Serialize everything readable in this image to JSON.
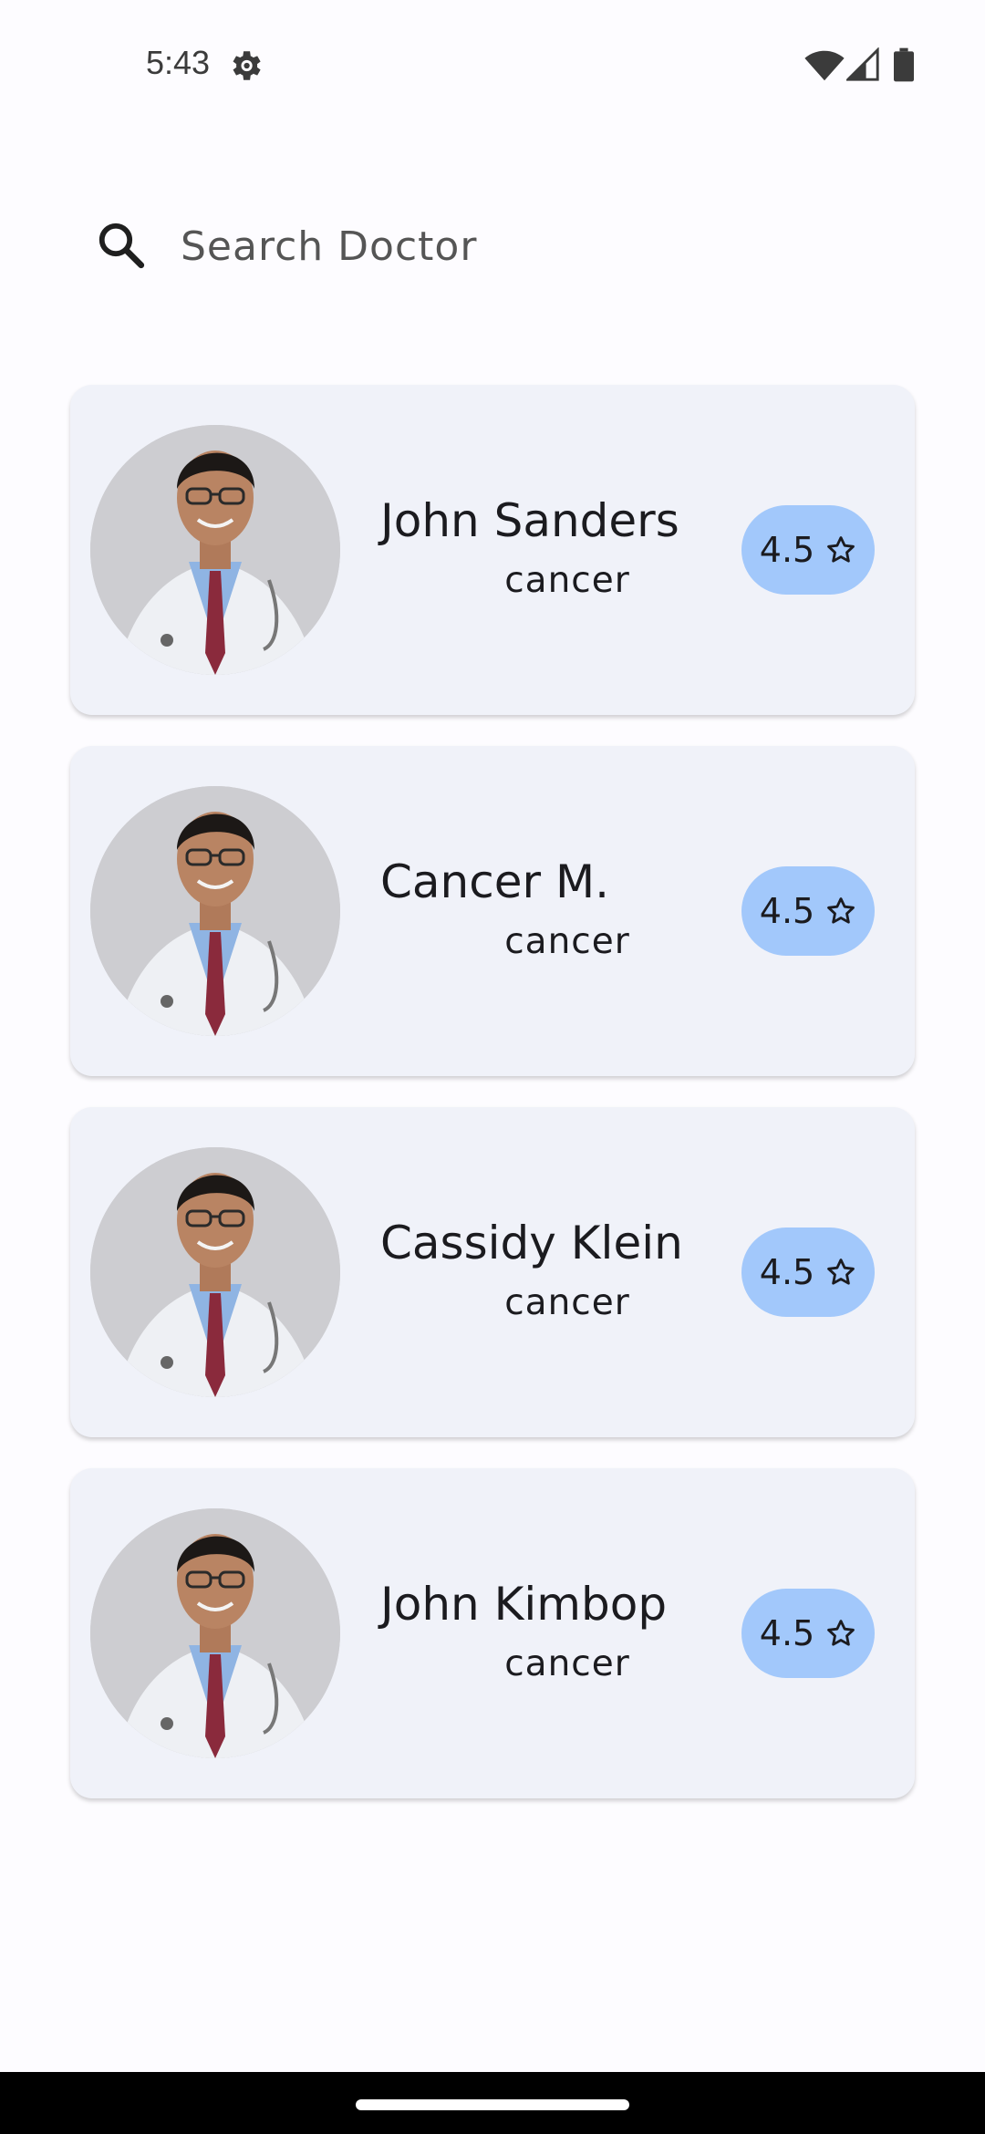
{
  "status_bar": {
    "time": "5:43",
    "icons": [
      "settings-gear-icon",
      "wifi-icon",
      "cellular-signal-icon",
      "battery-icon"
    ]
  },
  "search": {
    "placeholder": "Search Doctor",
    "value": "",
    "icon": "search-icon"
  },
  "doctors": [
    {
      "name": "John Sanders",
      "specialty": "cancer",
      "rating": "4.5"
    },
    {
      "name": "Cancer M.",
      "specialty": "cancer",
      "rating": "4.5"
    },
    {
      "name": "Cassidy Klein",
      "specialty": "cancer",
      "rating": "4.5"
    },
    {
      "name": "John Kimbop",
      "specialty": "cancer",
      "rating": "4.5"
    }
  ],
  "colors": {
    "background": "#fdfcff",
    "card": "#f0f2f9",
    "rating_badge": "#a2c8fb",
    "text": "#1b1b1f"
  }
}
